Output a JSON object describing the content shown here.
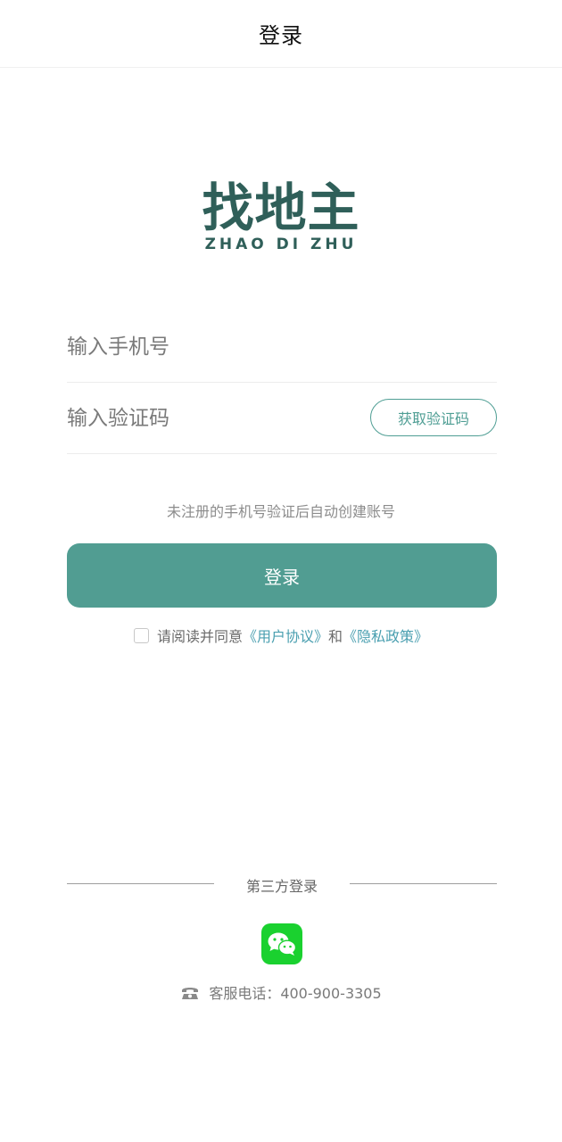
{
  "header": {
    "title": "登录"
  },
  "logo": {
    "cn": "找地主",
    "en": "ZHAO DI ZHU",
    "color": "#2f5f59"
  },
  "form": {
    "phone_placeholder": "输入手机号",
    "code_placeholder": "输入验证码",
    "get_code_label": "获取验证码",
    "hint": "未注册的手机号验证后自动创建账号",
    "login_label": "登录"
  },
  "agreement": {
    "prefix": "请阅读并同意",
    "user_agreement": "《用户协议》",
    "and": "和",
    "privacy_policy": "《隐私政策》",
    "checked": false
  },
  "third_party": {
    "label": "第三方登录",
    "wechat_icon": "wechat-icon"
  },
  "service": {
    "icon": "telephone-icon",
    "text": "客服电话：400-900-3305"
  },
  "colors": {
    "primary": "#519d92",
    "link": "#4a9fb0",
    "wechat": "#1ad12f"
  }
}
